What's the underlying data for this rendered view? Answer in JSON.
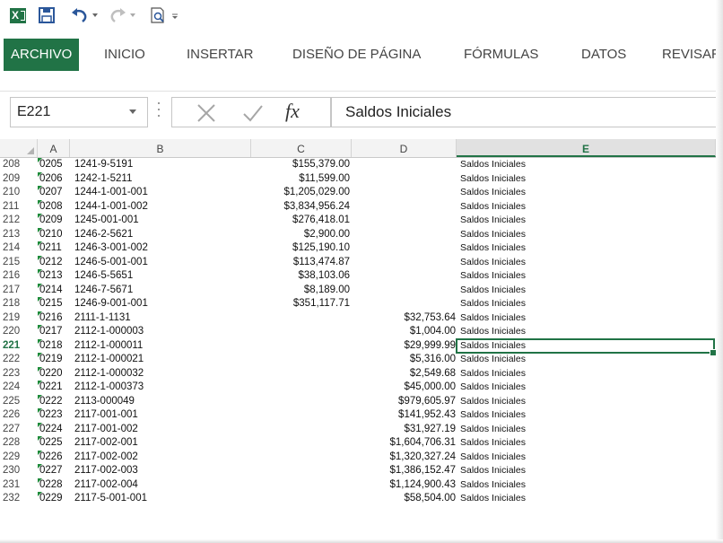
{
  "ribbon": {
    "tabs": [
      "ARCHIVO",
      "INICIO",
      "INSERTAR",
      "DISEÑO DE PÁGINA",
      "FÓRMULAS",
      "DATOS",
      "REVISAR"
    ]
  },
  "formula_bar": {
    "name_box": "E221",
    "formula": "Saldos Iniciales",
    "fx_label": "fx"
  },
  "columns": [
    "A",
    "B",
    "C",
    "D",
    "E"
  ],
  "selected_cell": {
    "row": "221",
    "column": "E"
  },
  "rows": [
    {
      "num": "208",
      "a": "0205",
      "b": "1241-9-5191",
      "c": "$155,379.00",
      "d": "",
      "e": "Saldos Iniciales"
    },
    {
      "num": "209",
      "a": "0206",
      "b": "1242-1-5211",
      "c": "$11,599.00",
      "d": "",
      "e": "Saldos Iniciales"
    },
    {
      "num": "210",
      "a": "0207",
      "b": "1244-1-001-001",
      "c": "$1,205,029.00",
      "d": "",
      "e": "Saldos Iniciales"
    },
    {
      "num": "211",
      "a": "0208",
      "b": "1244-1-001-002",
      "c": "$3,834,956.24",
      "d": "",
      "e": "Saldos Iniciales"
    },
    {
      "num": "212",
      "a": "0209",
      "b": "1245-001-001",
      "c": "$276,418.01",
      "d": "",
      "e": "Saldos Iniciales"
    },
    {
      "num": "213",
      "a": "0210",
      "b": "1246-2-5621",
      "c": "$2,900.00",
      "d": "",
      "e": "Saldos Iniciales"
    },
    {
      "num": "214",
      "a": "0211",
      "b": "1246-3-001-002",
      "c": "$125,190.10",
      "d": "",
      "e": "Saldos Iniciales"
    },
    {
      "num": "215",
      "a": "0212",
      "b": "1246-5-001-001",
      "c": "$113,474.87",
      "d": "",
      "e": "Saldos Iniciales"
    },
    {
      "num": "216",
      "a": "0213",
      "b": "1246-5-5651",
      "c": "$38,103.06",
      "d": "",
      "e": "Saldos Iniciales"
    },
    {
      "num": "217",
      "a": "0214",
      "b": "1246-7-5671",
      "c": "$8,189.00",
      "d": "",
      "e": "Saldos Iniciales"
    },
    {
      "num": "218",
      "a": "0215",
      "b": "1246-9-001-001",
      "c": "$351,117.71",
      "d": "",
      "e": "Saldos Iniciales"
    },
    {
      "num": "219",
      "a": "0216",
      "b": "2111-1-1131",
      "c": "",
      "d": "$32,753.64",
      "e": "Saldos Iniciales"
    },
    {
      "num": "220",
      "a": "0217",
      "b": "2112-1-000003",
      "c": "",
      "d": "$1,004.00",
      "e": "Saldos Iniciales"
    },
    {
      "num": "221",
      "a": "0218",
      "b": "2112-1-000011",
      "c": "",
      "d": "$29,999.99",
      "e": "Saldos Iniciales"
    },
    {
      "num": "222",
      "a": "0219",
      "b": "2112-1-000021",
      "c": "",
      "d": "$5,316.00",
      "e": "Saldos Iniciales"
    },
    {
      "num": "223",
      "a": "0220",
      "b": "2112-1-000032",
      "c": "",
      "d": "$2,549.68",
      "e": "Saldos Iniciales"
    },
    {
      "num": "224",
      "a": "0221",
      "b": "2112-1-000373",
      "c": "",
      "d": "$45,000.00",
      "e": "Saldos Iniciales"
    },
    {
      "num": "225",
      "a": "0222",
      "b": "2113-000049",
      "c": "",
      "d": "$979,605.97",
      "e": "Saldos Iniciales"
    },
    {
      "num": "226",
      "a": "0223",
      "b": "2117-001-001",
      "c": "",
      "d": "$141,952.43",
      "e": "Saldos Iniciales"
    },
    {
      "num": "227",
      "a": "0224",
      "b": "2117-001-002",
      "c": "",
      "d": "$31,927.19",
      "e": "Saldos Iniciales"
    },
    {
      "num": "228",
      "a": "0225",
      "b": "2117-002-001",
      "c": "",
      "d": "$1,604,706.31",
      "e": "Saldos Iniciales"
    },
    {
      "num": "229",
      "a": "0226",
      "b": "2117-002-002",
      "c": "",
      "d": "$1,320,327.24",
      "e": "Saldos Iniciales"
    },
    {
      "num": "230",
      "a": "0227",
      "b": "2117-002-003",
      "c": "",
      "d": "$1,386,152.47",
      "e": "Saldos Iniciales"
    },
    {
      "num": "231",
      "a": "0228",
      "b": "2117-002-004",
      "c": "",
      "d": "$1,124,900.43",
      "e": "Saldos Iniciales"
    },
    {
      "num": "232",
      "a": "0229",
      "b": "2117-5-001-001",
      "c": "",
      "d": "$58,504.00",
      "e": "Saldos Iniciales"
    }
  ],
  "colors": {
    "accent": "#217346",
    "indicator": "#1e8a3a"
  }
}
